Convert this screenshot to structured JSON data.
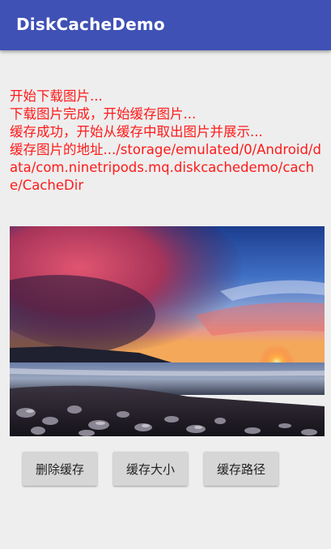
{
  "app": {
    "title": "DiskCacheDemo"
  },
  "log": {
    "lines": [
      "开始下载图片...",
      "下载图片完成，开始缓存图片...",
      "缓存成功，开始从缓存中取出图片并展示...",
      "缓存图片的地址.../storage/emulated/0/Android/data/com.ninetripods.mq.diskcachedemo/cache/CacheDir"
    ],
    "color": "#ff1a1a"
  },
  "image": {
    "subject": "sunset-over-rocky-beach"
  },
  "buttons": {
    "delete_cache": "删除缓存",
    "cache_size": "缓存大小",
    "cache_path": "缓存路径"
  },
  "theme": {
    "primary": "#3f51b5",
    "background": "#eeeeee"
  }
}
